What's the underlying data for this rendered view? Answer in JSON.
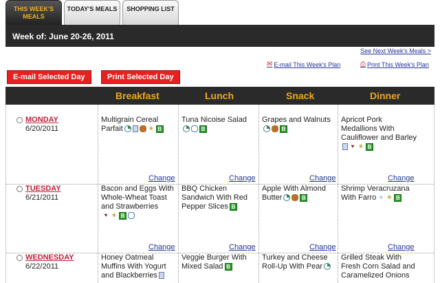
{
  "tabs": [
    {
      "label_line1": "THIS WEEK'S",
      "label_line2": "MEALS"
    },
    {
      "label_line1": "TODAY'S MEALS",
      "label_line2": ""
    },
    {
      "label_line1": "SHOPPING LIST",
      "label_line2": ""
    }
  ],
  "week_label": "Week of: June 20-26, 2011",
  "links": {
    "next_week": "See Next Week's Meals >",
    "email_plan": "E-mail This Week's Plan",
    "print_plan": "Print This Week's Plan"
  },
  "buttons": {
    "email_day": "E-mail Selected Day",
    "print_day": "Print Selected Day"
  },
  "columns": [
    "Breakfast",
    "Lunch",
    "Snack",
    "Dinner"
  ],
  "change_label": "Change",
  "days": [
    {
      "name": "MONDAY",
      "date": "6/20/2011",
      "meals": [
        {
          "text": "Multigrain Cereal Parfait",
          "icons": [
            "clock-icon",
            "cup-icon",
            "nut-icon",
            "grain-icon",
            "b-badge-icon"
          ]
        },
        {
          "text": "Tuna Nicoise Salad",
          "icons": [
            "clock-icon",
            "bowl-icon",
            "b-badge-icon"
          ]
        },
        {
          "text": "Grapes and Walnuts",
          "icons": [
            "clock-icon",
            "nut-icon",
            "b-badge-icon"
          ]
        },
        {
          "text": "Apricot Pork Medallions With Cauliflower and Barley",
          "icons": [
            "cup-icon",
            "heart-icon",
            "grain-icon",
            "b-badge-icon"
          ]
        }
      ]
    },
    {
      "name": "TUESDAY",
      "date": "6/21/2011",
      "meals": [
        {
          "text": "Bacon and Eggs With Whole-Wheat Toast and Strawberries",
          "icons": [
            "heart-icon",
            "grain-icon",
            "b-badge-icon",
            "bowl-icon"
          ]
        },
        {
          "text": "BBQ Chicken Sandwich With Red Pepper Slices",
          "icons": [
            "b-badge-icon"
          ]
        },
        {
          "text": "Apple With Almond Butter",
          "icons": [
            "clock-icon",
            "nut-icon",
            "b-badge-icon"
          ]
        },
        {
          "text": "Shrimp Veracruzana With Farro",
          "icons": [
            "fish-icon",
            "grain-icon",
            "b-badge-icon"
          ]
        }
      ]
    },
    {
      "name": "WEDNESDAY",
      "date": "6/22/2011",
      "meals": [
        {
          "text": "Honey Oatmeal Muffins With Yogurt and Blackberries",
          "icons": [
            "cup-icon"
          ]
        },
        {
          "text": "Veggie Burger With Mixed Salad",
          "icons": [
            "b-badge-icon"
          ]
        },
        {
          "text": "Turkey and Cheese Roll-Up With Pear",
          "icons": [
            "clock-icon"
          ]
        },
        {
          "text": "Grilled Steak With Fresh Corn Salad and Caramelized Onions",
          "icons": []
        }
      ]
    }
  ],
  "colors": {
    "accent": "#f0a818",
    "header_bg": "#2a2a2a",
    "button_red": "#e82020",
    "day_name": "#c0203a",
    "link": "#223399"
  }
}
